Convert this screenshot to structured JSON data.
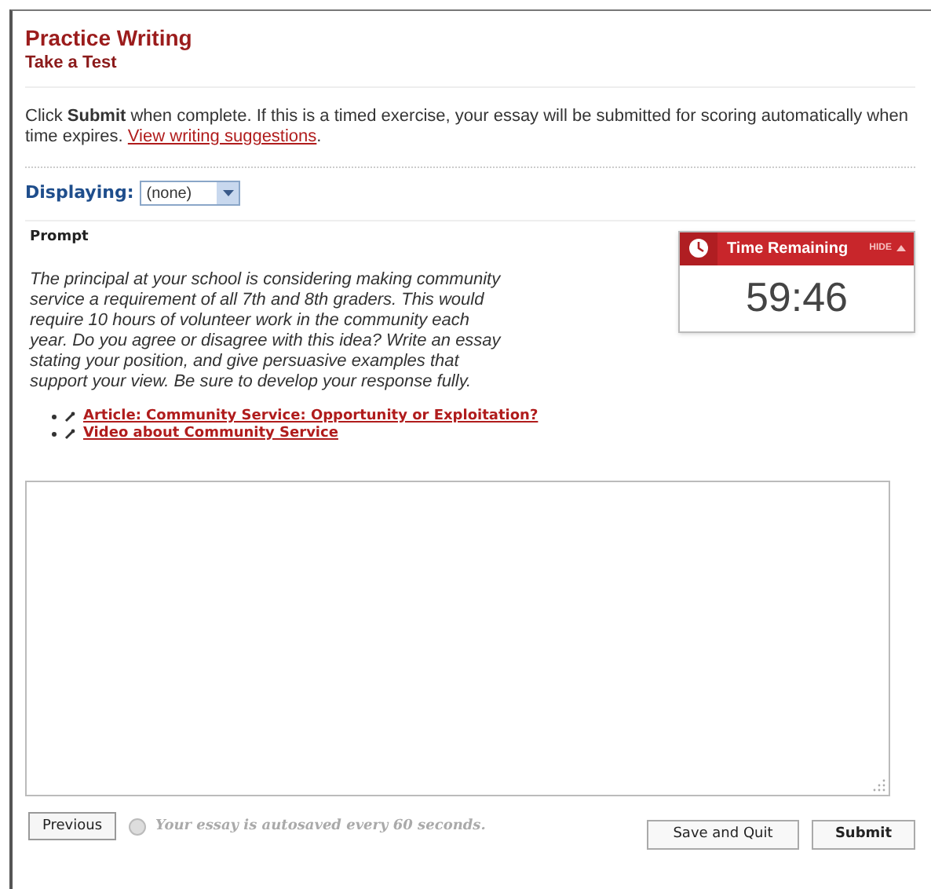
{
  "header": {
    "title": "Practice Writing",
    "subtitle": "Take a Test"
  },
  "intro": {
    "text": "Click **Submit** when complete. If this is a timed exercise, your essay will be submitted for scoring automatically when time expires.",
    "link": "View writing suggestions",
    "after": "."
  },
  "display": {
    "label": "Displaying:",
    "value": "(none)"
  },
  "prompt": {
    "heading": "Prompt",
    "text": "The principal at your school is considering making community service a requirement of all 7th and 8th graders. This would require 10 hours of volunteer work in the community each year. Do you agree or disagree with this idea? Write an essay stating your position, and give persuasive examples that support your view. Be sure to develop your response fully.",
    "links": [
      "Article: Community Service: Opportunity or Exploitation?",
      "Video about Community Service"
    ]
  },
  "timer": {
    "title": "Time Remaining",
    "hide": "HIDE",
    "time": "59:46"
  },
  "footer": {
    "previous": "Previous",
    "note": "Your essay is autosaved every 60 seconds.",
    "buttons": [
      "Save and Quit",
      "Submit"
    ]
  }
}
